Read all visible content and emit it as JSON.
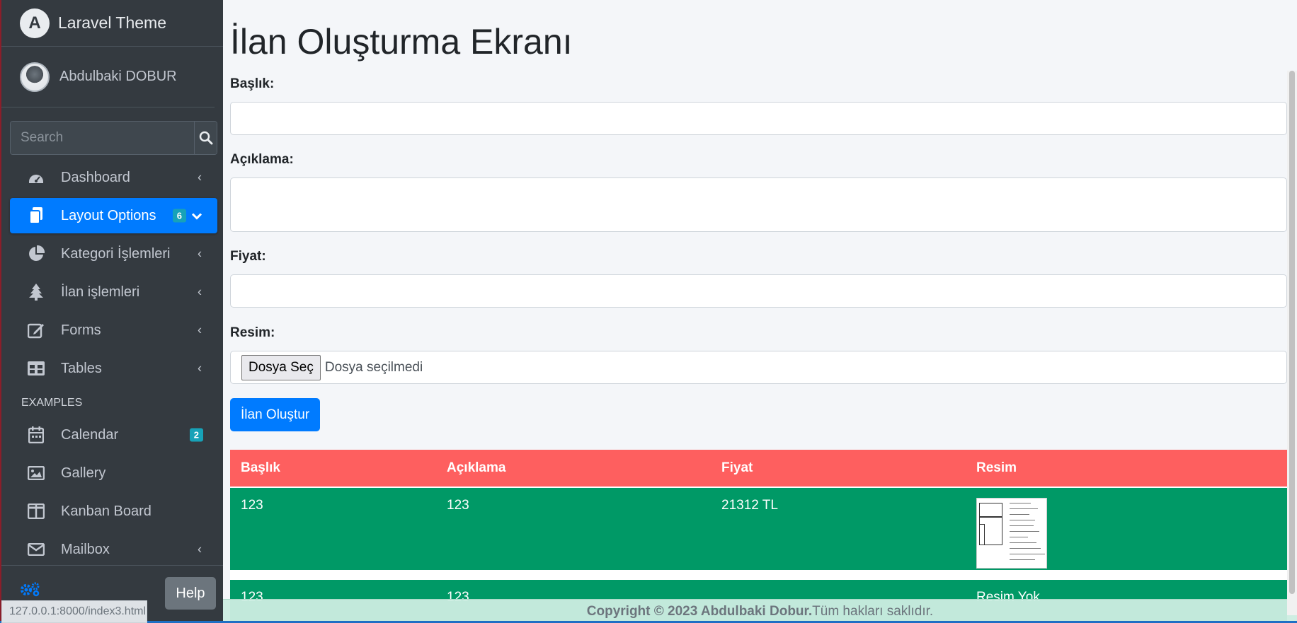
{
  "brand": {
    "title": "Laravel Theme",
    "logo_letter": "A"
  },
  "user": {
    "name": "Abdulbaki DOBUR"
  },
  "search": {
    "placeholder": "Search"
  },
  "nav": {
    "items": [
      {
        "label": "Dashboard",
        "icon": "tachometer-icon",
        "chevron": "‹"
      },
      {
        "label": "Layout Options",
        "icon": "copy-icon",
        "badge": "6",
        "chevron": "⌄",
        "active": true
      },
      {
        "label": "Kategori İşlemleri",
        "icon": "chart-pie-icon",
        "chevron": "‹"
      },
      {
        "label": "İlan işlemleri",
        "icon": "tree-icon",
        "chevron": "‹"
      },
      {
        "label": "Forms",
        "icon": "edit-icon",
        "chevron": "‹"
      },
      {
        "label": "Tables",
        "icon": "table-icon",
        "chevron": "‹"
      }
    ],
    "header": "EXAMPLES",
    "examples": [
      {
        "label": "Calendar",
        "icon": "calendar-icon",
        "badge": "2"
      },
      {
        "label": "Gallery",
        "icon": "image-icon"
      },
      {
        "label": "Kanban Board",
        "icon": "columns-icon"
      },
      {
        "label": "Mailbox",
        "icon": "envelope-icon",
        "chevron": "‹"
      }
    ]
  },
  "sidebar_footer": {
    "help_label": "Help",
    "status_url": "127.0.0.1:8000/index3.html"
  },
  "main": {
    "title": "İlan Oluşturma Ekranı",
    "fields": {
      "title_label": "Başlık:",
      "title_value": "",
      "desc_label": "Açıklama:",
      "desc_value": "",
      "price_label": "Fiyat:",
      "price_value": "",
      "image_label": "Resim:",
      "file_button": "Dosya Seç",
      "file_status": "Dosya seçilmedi"
    },
    "submit_label": "İlan Oluştur",
    "table": {
      "headers": [
        "Başlık",
        "Açıklama",
        "Fiyat",
        "Resim"
      ],
      "rows": [
        {
          "title": "123",
          "desc": "123",
          "price": "21312 TL",
          "image": ""
        },
        {
          "title": "123",
          "desc": "123",
          "price": "",
          "image": "Resim Yok"
        }
      ]
    }
  },
  "footer": {
    "copyright_bold": "Copyright © 2023 Abdulbaki Dobur.",
    "rights": " Tüm hakları saklıdır."
  },
  "colors": {
    "accent": "#007bff",
    "table_header": "#fe5f5f",
    "table_row": "#009966",
    "sidebar": "#343a40"
  }
}
